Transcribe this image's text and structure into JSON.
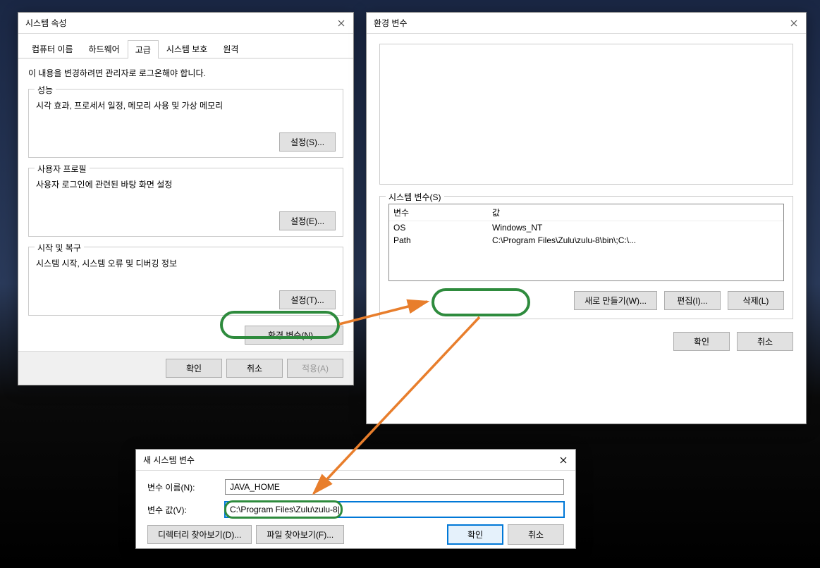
{
  "sysprops": {
    "title": "시스템 속성",
    "tabs": [
      "컴퓨터 이름",
      "하드웨어",
      "고급",
      "시스템 보호",
      "원격"
    ],
    "active_tab": 2,
    "notice": "이 내용을 변경하려면 관리자로 로그온해야 합니다.",
    "perf": {
      "label": "성능",
      "desc": "시각 효과, 프로세서 일정, 메모리 사용 및 가상 메모리",
      "button": "설정(S)..."
    },
    "profile": {
      "label": "사용자 프로필",
      "desc": "사용자 로그인에 관련된 바탕 화면 설정",
      "button": "설정(E)..."
    },
    "startup": {
      "label": "시작 및 복구",
      "desc": "시스템 시작, 시스템 오류 및 디버깅 정보",
      "button": "설정(T)..."
    },
    "env_button": "환경 변수(N)...",
    "ok": "확인",
    "cancel": "취소",
    "apply": "적용(A)"
  },
  "envvars": {
    "title": "환경 변수",
    "sysvars_label": "시스템 변수(S)",
    "columns": {
      "var": "변수",
      "val": "값"
    },
    "rows": [
      {
        "var": "OS",
        "val": "Windows_NT"
      },
      {
        "var": "Path",
        "val": "C:\\Program Files\\Zulu\\zulu-8\\bin\\;C:\\..."
      }
    ],
    "new": "새로 만들기(W)...",
    "edit": "편집(I)...",
    "delete": "삭제(L)",
    "ok": "확인",
    "cancel": "취소"
  },
  "newvar": {
    "title": "새 시스템 변수",
    "name_label": "변수 이름(N):",
    "name_value": "JAVA_HOME",
    "value_label": "변수 값(V):",
    "value_value": "C:\\Program Files\\Zulu\\zulu-8|",
    "browse_dir": "디렉터리 찾아보기(D)...",
    "browse_file": "파일 찾아보기(F)...",
    "ok": "확인",
    "cancel": "취소"
  }
}
